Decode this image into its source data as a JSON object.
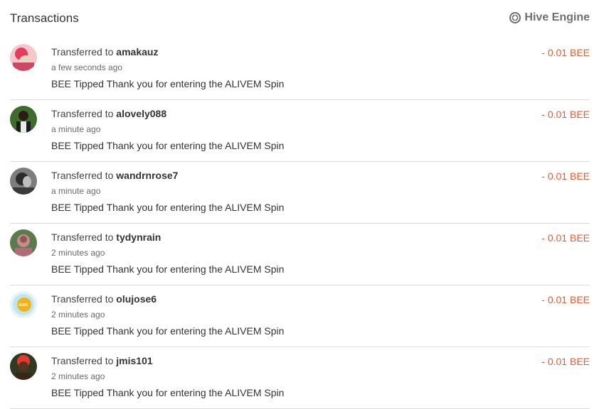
{
  "header": {
    "title": "Transactions",
    "engine_label": "Hive Engine",
    "engine_icon": "hive-engine-logo-icon"
  },
  "transactions": [
    {
      "prefix": "Transferred to ",
      "user": "amakauz",
      "time": "a few seconds ago",
      "memo": "BEE Tipped Thank you for entering the ALIVEM Spin",
      "amount": "- 0.01 BEE"
    },
    {
      "prefix": "Transferred to ",
      "user": "alovely088",
      "time": "a minute ago",
      "memo": "BEE Tipped Thank you for entering the ALIVEM Spin",
      "amount": "- 0.01 BEE"
    },
    {
      "prefix": "Transferred to ",
      "user": "wandrnrose7",
      "time": "a minute ago",
      "memo": "BEE Tipped Thank you for entering the ALIVEM Spin",
      "amount": "- 0.01 BEE"
    },
    {
      "prefix": "Transferred to ",
      "user": "tydynrain",
      "time": "2 minutes ago",
      "memo": "BEE Tipped Thank you for entering the ALIVEM Spin",
      "amount": "- 0.01 BEE"
    },
    {
      "prefix": "Transferred to ",
      "user": "olujose6",
      "time": "2 minutes ago",
      "memo": "BEE Tipped Thank you for entering the ALIVEM Spin",
      "amount": "- 0.01 BEE"
    },
    {
      "prefix": "Transferred to ",
      "user": "jmis101",
      "time": "2 minutes ago",
      "memo": "BEE Tipped Thank you for entering the ALIVEM Spin",
      "amount": "- 0.01 BEE"
    }
  ],
  "colors": {
    "amount_negative": "#e45b33",
    "divider": "#dcdcdc",
    "muted": "#6f6f6f"
  }
}
